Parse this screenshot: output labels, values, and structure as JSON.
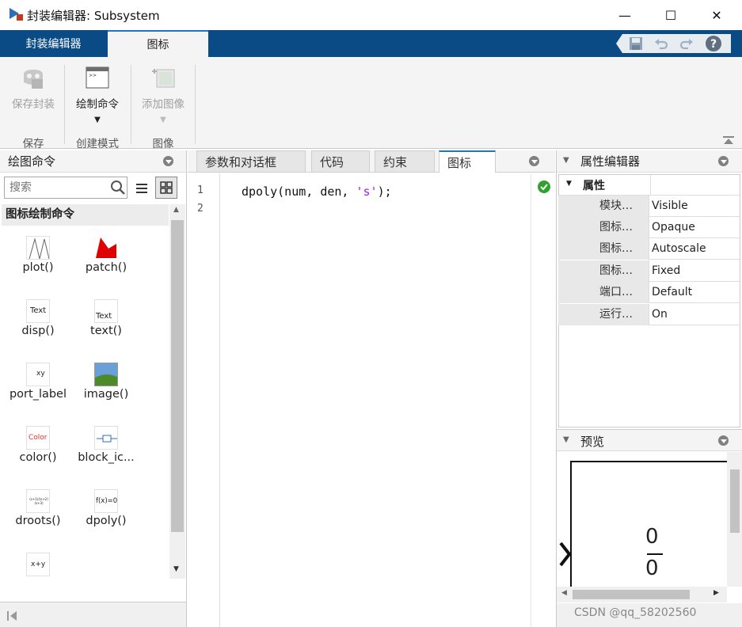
{
  "window": {
    "title": "封装编辑器: Subsystem",
    "minimize": "—",
    "maximize": "☐",
    "close": "✕"
  },
  "tabs": [
    {
      "label": "封装编辑器"
    },
    {
      "label": "图标"
    }
  ],
  "ribbon": {
    "save_mask": "保存封装",
    "draw_command": "绘制命令",
    "add_image": "添加图像",
    "groups": {
      "save": "保存",
      "create_mode": "创建模式",
      "image": "图像"
    }
  },
  "left_panel": {
    "title": "绘图命令",
    "search_placeholder": "搜索",
    "section": "图标绘制命令",
    "commands": [
      {
        "label": "plot()",
        "icon": "plot-icon",
        "thumb": ""
      },
      {
        "label": "patch()",
        "icon": "patch-icon",
        "thumb": ""
      },
      {
        "label": "disp()",
        "icon": "disp-icon",
        "thumb": "Text"
      },
      {
        "label": "text()",
        "icon": "text-icon",
        "thumb": "Text"
      },
      {
        "label": "port_label",
        "icon": "port-label-icon",
        "thumb": "xy"
      },
      {
        "label": "image()",
        "icon": "image-icon",
        "thumb": ""
      },
      {
        "label": "color()",
        "icon": "color-icon",
        "thumb": "Color"
      },
      {
        "label": "block_ic...",
        "icon": "block-icon",
        "thumb": ""
      },
      {
        "label": "droots()",
        "icon": "droots-icon",
        "thumb": "(s+1)/(s+2)(s+3)"
      },
      {
        "label": "dpoly()",
        "icon": "dpoly-icon",
        "thumb": "f(x)=0"
      },
      {
        "label": "",
        "icon": "fcn-icon",
        "thumb": "x+y"
      }
    ]
  },
  "editor": {
    "tabs": [
      "参数和对话框",
      "代码",
      "约束",
      "图标"
    ],
    "lines": [
      {
        "num": "1",
        "pre": "dpoly(num, den, ",
        "str": "'s'",
        "post": ");"
      },
      {
        "num": "2",
        "pre": "",
        "str": "",
        "post": ""
      }
    ]
  },
  "property_editor": {
    "title": "属性编辑器",
    "section": "属性",
    "rows": [
      {
        "key": "模块…",
        "value": "Visible"
      },
      {
        "key": "图标…",
        "value": "Opaque"
      },
      {
        "key": "图标…",
        "value": "Autoscale"
      },
      {
        "key": "图标…",
        "value": "Fixed"
      },
      {
        "key": "端口…",
        "value": "Default"
      },
      {
        "key": "运行…",
        "value": "On"
      }
    ]
  },
  "preview": {
    "title": "预览",
    "numerator": "0",
    "denominator": "0"
  },
  "watermark": "CSDN @qq_58202560",
  "colors": {
    "accent": "#0a4b86",
    "tab_highlight": "#1f74c7",
    "string": "#a020f0",
    "ok": "#2ea12e"
  }
}
